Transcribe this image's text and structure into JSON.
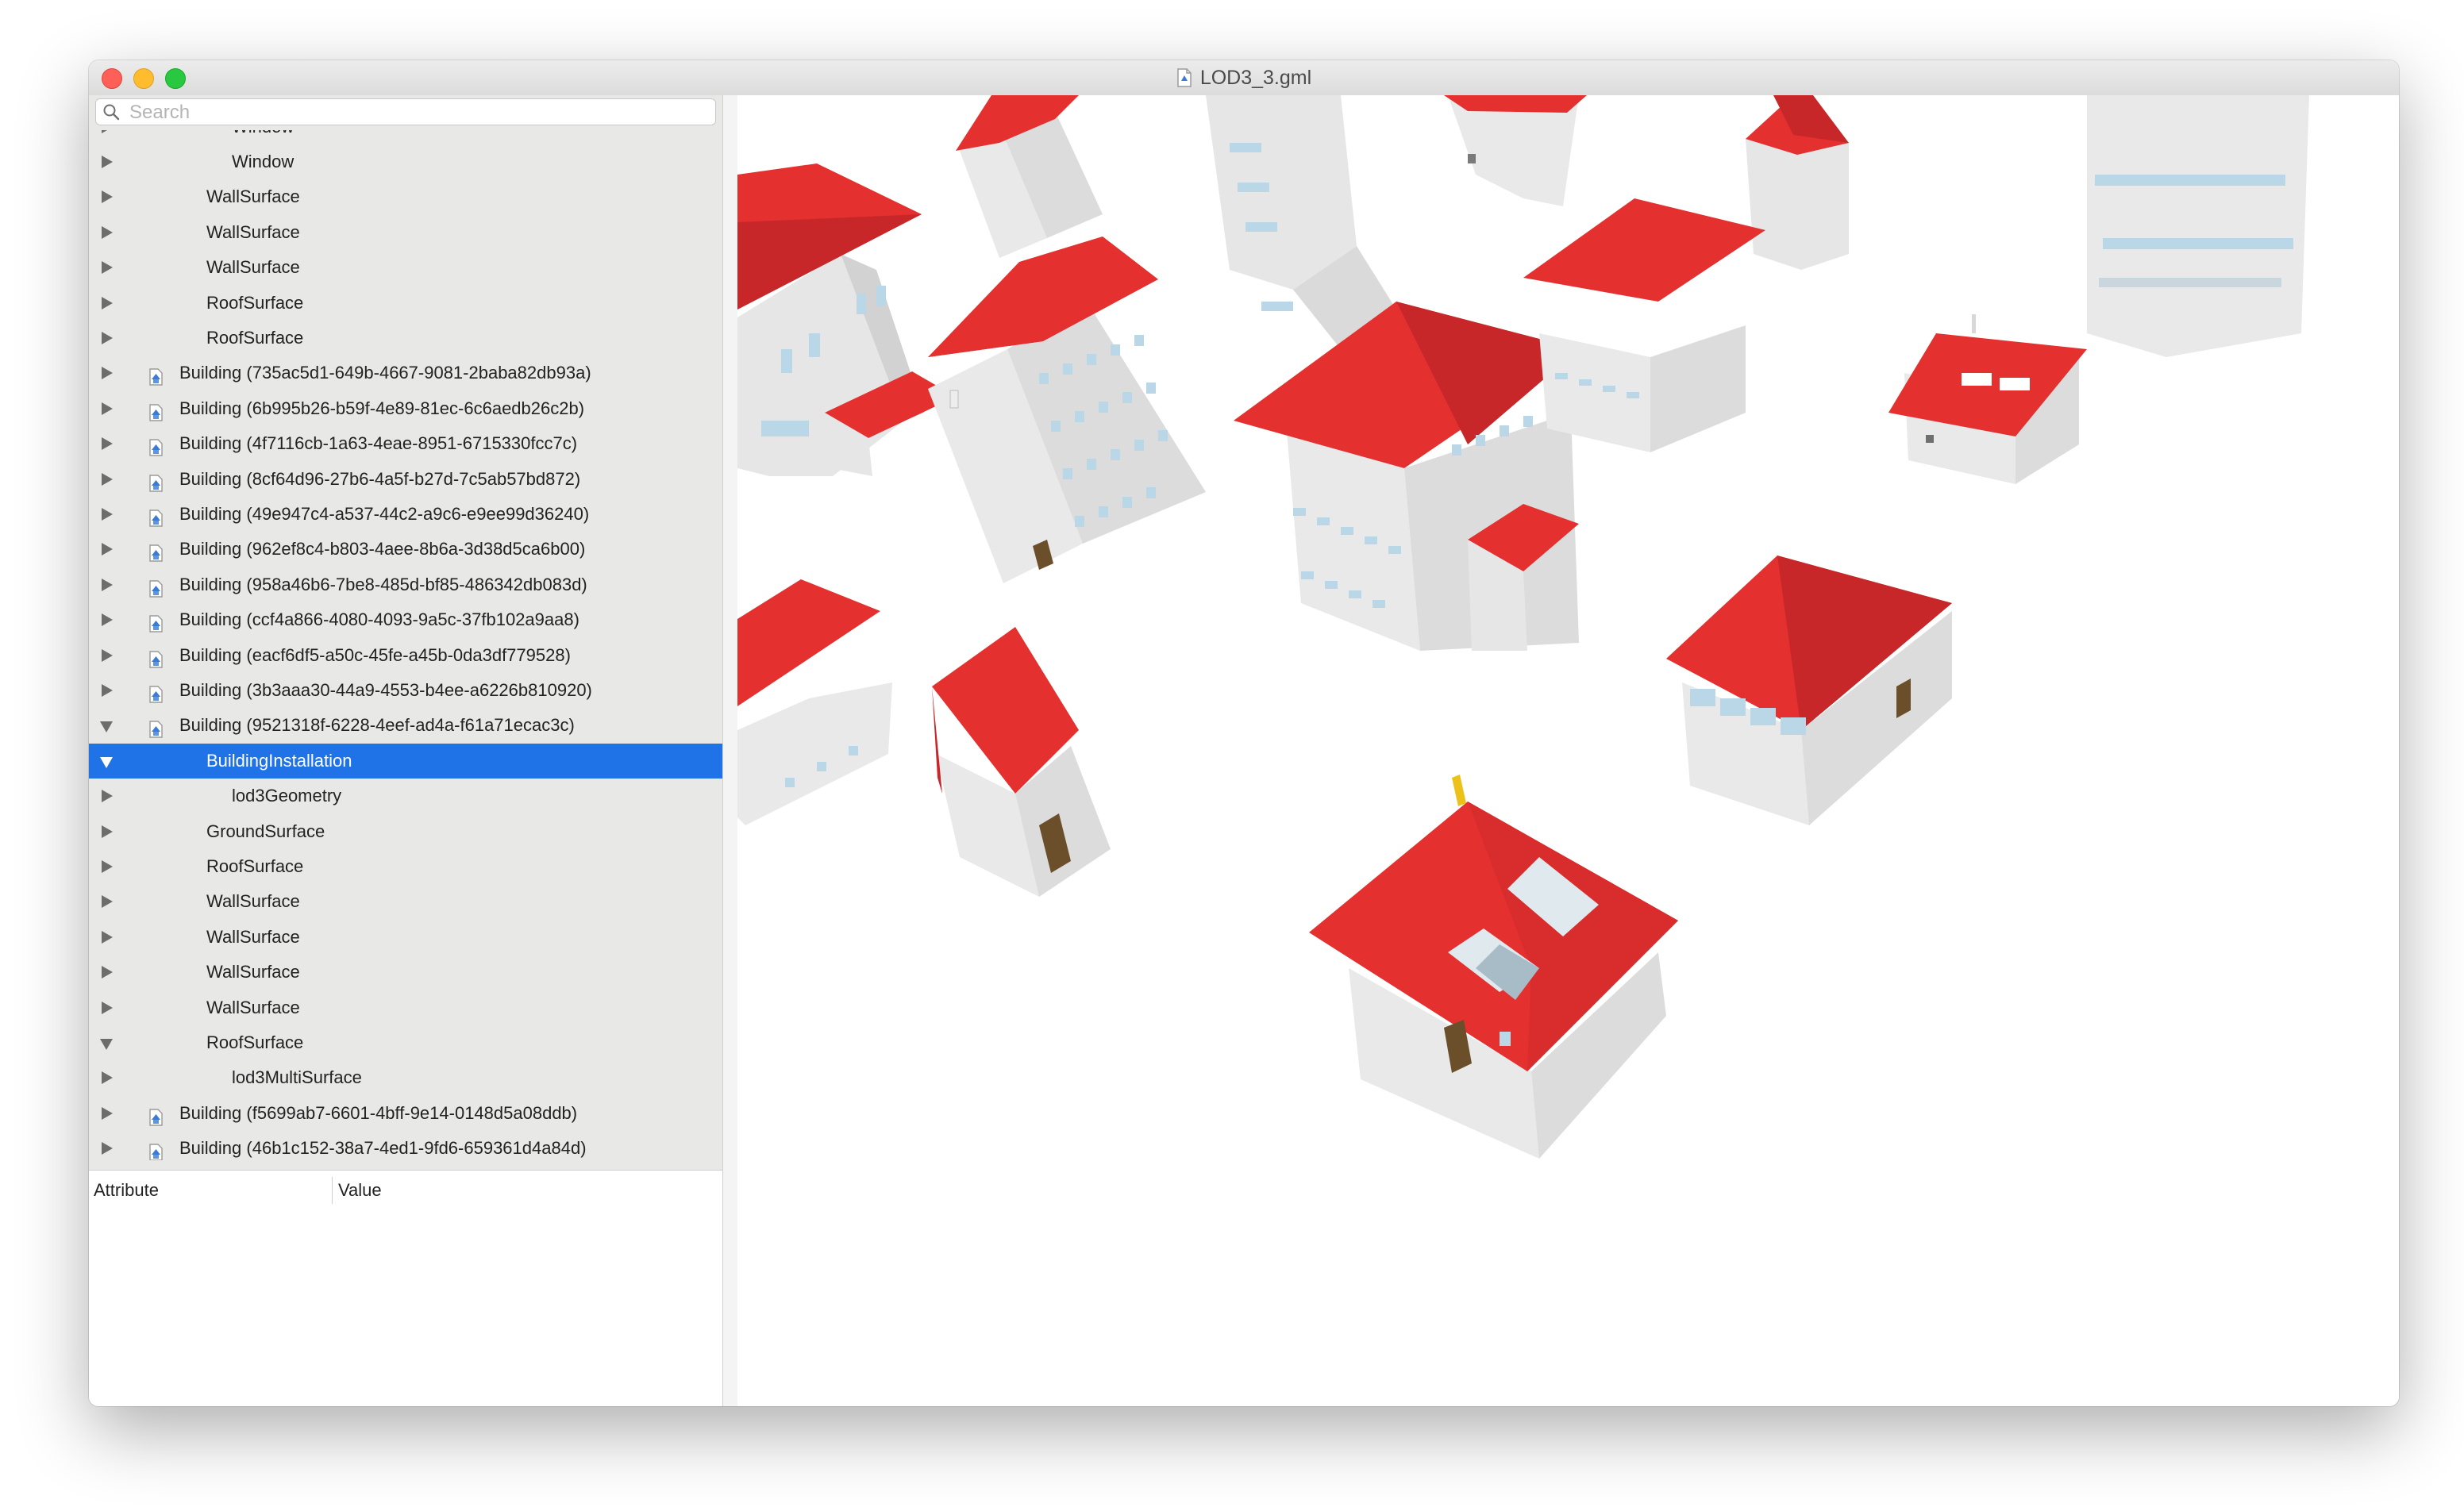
{
  "window": {
    "title": "LOD3_3.gml"
  },
  "search": {
    "placeholder": "Search",
    "value": ""
  },
  "tree": {
    "partial_top_label": "Window",
    "rows": [
      {
        "label": "Window",
        "level": 3,
        "icon": "",
        "expanded": false,
        "selected": false
      },
      {
        "label": "WallSurface",
        "level": 2,
        "icon": "",
        "expanded": false,
        "selected": false
      },
      {
        "label": "WallSurface",
        "level": 2,
        "icon": "",
        "expanded": false,
        "selected": false
      },
      {
        "label": "WallSurface",
        "level": 2,
        "icon": "",
        "expanded": false,
        "selected": false
      },
      {
        "label": "RoofSurface",
        "level": 2,
        "icon": "",
        "expanded": false,
        "selected": false
      },
      {
        "label": "RoofSurface",
        "level": 2,
        "icon": "",
        "expanded": false,
        "selected": false
      },
      {
        "label": "Building (735ac5d1-649b-4667-9081-2baba82db93a)",
        "level": 1,
        "icon": "building-icon",
        "expanded": false,
        "selected": false
      },
      {
        "label": "Building (6b995b26-b59f-4e89-81ec-6c6aedb26c2b)",
        "level": 1,
        "icon": "building-icon",
        "expanded": false,
        "selected": false
      },
      {
        "label": "Building (4f7116cb-1a63-4eae-8951-6715330fcc7c)",
        "level": 1,
        "icon": "building-icon",
        "expanded": false,
        "selected": false
      },
      {
        "label": "Building (8cf64d96-27b6-4a5f-b27d-7c5ab57bd872)",
        "level": 1,
        "icon": "building-icon",
        "expanded": false,
        "selected": false
      },
      {
        "label": "Building (49e947c4-a537-44c2-a9c6-e9ee99d36240)",
        "level": 1,
        "icon": "building-icon",
        "expanded": false,
        "selected": false
      },
      {
        "label": "Building (962ef8c4-b803-4aee-8b6a-3d38d5ca6b00)",
        "level": 1,
        "icon": "building-icon",
        "expanded": false,
        "selected": false
      },
      {
        "label": "Building (958a46b6-7be8-485d-bf85-486342db083d)",
        "level": 1,
        "icon": "building-icon",
        "expanded": false,
        "selected": false
      },
      {
        "label": "Building (ccf4a866-4080-4093-9a5c-37fb102a9aa8)",
        "level": 1,
        "icon": "building-icon",
        "expanded": false,
        "selected": false
      },
      {
        "label": "Building (eacf6df5-a50c-45fe-a45b-0da3df779528)",
        "level": 1,
        "icon": "building-icon",
        "expanded": false,
        "selected": false
      },
      {
        "label": "Building (3b3aaa30-44a9-4553-b4ee-a6226b810920)",
        "level": 1,
        "icon": "building-icon",
        "expanded": false,
        "selected": false
      },
      {
        "label": "Building (9521318f-6228-4eef-ad4a-f61a71ecac3c)",
        "level": 1,
        "icon": "building-icon",
        "expanded": true,
        "selected": false
      },
      {
        "label": "BuildingInstallation",
        "level": 2,
        "icon": "",
        "expanded": true,
        "selected": true
      },
      {
        "label": "lod3Geometry",
        "level": 3,
        "icon": "",
        "expanded": false,
        "selected": false
      },
      {
        "label": "GroundSurface",
        "level": 2,
        "icon": "",
        "expanded": false,
        "selected": false
      },
      {
        "label": "RoofSurface",
        "level": 2,
        "icon": "",
        "expanded": false,
        "selected": false
      },
      {
        "label": "WallSurface",
        "level": 2,
        "icon": "",
        "expanded": false,
        "selected": false
      },
      {
        "label": "WallSurface",
        "level": 2,
        "icon": "",
        "expanded": false,
        "selected": false
      },
      {
        "label": "WallSurface",
        "level": 2,
        "icon": "",
        "expanded": false,
        "selected": false
      },
      {
        "label": "WallSurface",
        "level": 2,
        "icon": "",
        "expanded": false,
        "selected": false
      },
      {
        "label": "RoofSurface",
        "level": 2,
        "icon": "",
        "expanded": true,
        "selected": false
      },
      {
        "label": "lod3MultiSurface",
        "level": 3,
        "icon": "",
        "expanded": false,
        "selected": false
      },
      {
        "label": "Building (f5699ab7-6601-4bff-9e14-0148d5a08ddb)",
        "level": 1,
        "icon": "building-icon",
        "expanded": false,
        "selected": false
      },
      {
        "label": "Building (46b1c152-38a7-4ed1-9fd6-659361d4a84d)",
        "level": 1,
        "icon": "building-icon",
        "expanded": false,
        "selected": false
      }
    ]
  },
  "attributes": {
    "headers": [
      "Attribute",
      "Value"
    ],
    "rows": []
  },
  "colors": {
    "selection": "#1f73e6",
    "roof": "#e4302f",
    "wall": "#e8e8e8",
    "window": "#b9d7e6",
    "door": "#6b4f2a",
    "chimney": "#ecc21a"
  }
}
